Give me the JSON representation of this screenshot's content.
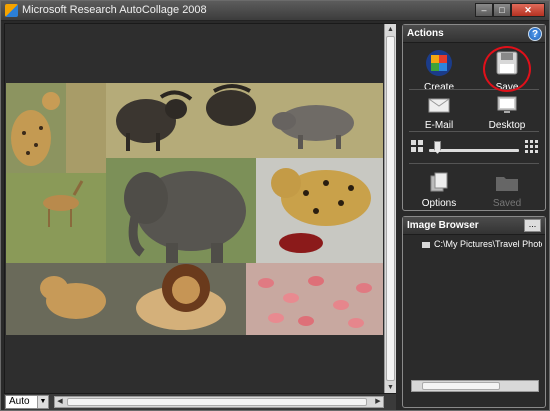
{
  "window": {
    "title": "Microsoft Research AutoCollage 2008"
  },
  "canvas": {
    "zoom_mode": "Auto",
    "collage_image": "african-wildlife-collage"
  },
  "actions_panel": {
    "header": "Actions",
    "create_label": "Create",
    "save_label": "Save",
    "email_label": "E-Mail",
    "desktop_label": "Desktop",
    "options_label": "Options",
    "saved_label": "Saved",
    "highlight_color": "#e0101a"
  },
  "image_browser": {
    "header": "Image Browser",
    "browse_label": "...",
    "folder_path": "C:\\My Pictures\\Travel Photos\\"
  }
}
